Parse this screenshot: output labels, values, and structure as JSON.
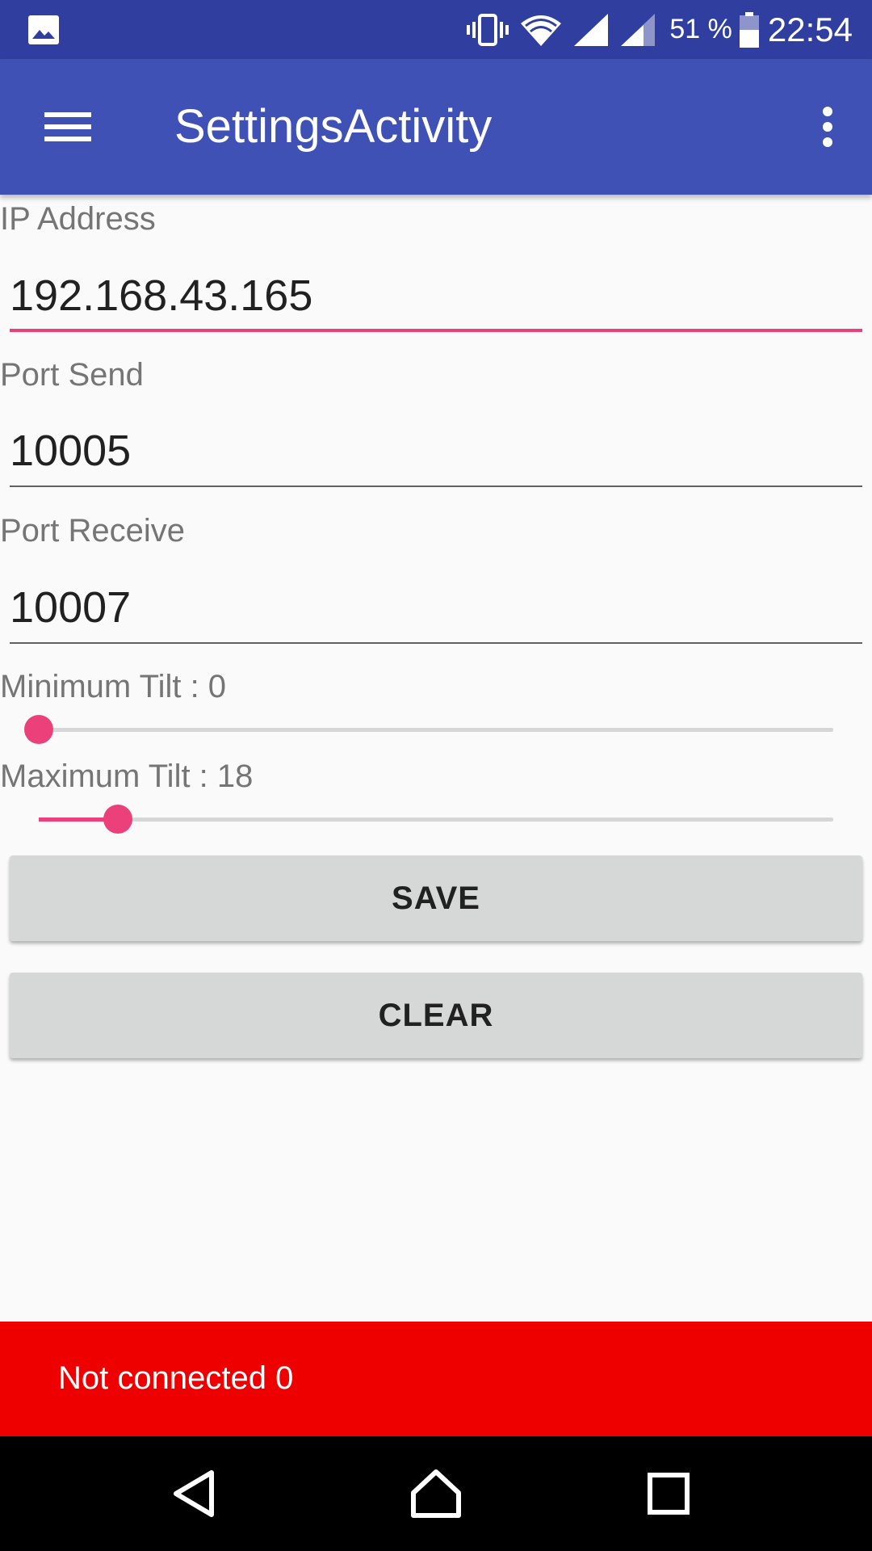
{
  "status_bar": {
    "battery_text": "51 %",
    "time": "22:54",
    "icons": [
      "gallery-icon",
      "vibrate-icon",
      "wifi-icon",
      "signal-icon",
      "signal-icon",
      "battery-icon"
    ]
  },
  "app_bar": {
    "title": "SettingsActivity",
    "menu_icon": "menu-icon",
    "more_icon": "more-vert-icon"
  },
  "form": {
    "ip_label": "IP Address",
    "ip_value": "192.168.43.165",
    "port_send_label": "Port Send",
    "port_send_value": "10005",
    "port_receive_label": "Port Receive",
    "port_receive_value": "10007",
    "min_tilt_label": "Minimum Tilt : 0",
    "min_tilt_level": 0.0,
    "max_tilt_label": "Maximum Tilt : 18",
    "max_tilt_level": 0.1
  },
  "buttons": {
    "save": "SAVE",
    "clear": "CLEAR"
  },
  "snackbar": {
    "text": "Not connected 0"
  },
  "colors": {
    "status_bar": "#303f9f",
    "app_bar": "#3f51b5",
    "accent": "#ec407a",
    "snackbar": "#ee0000"
  }
}
